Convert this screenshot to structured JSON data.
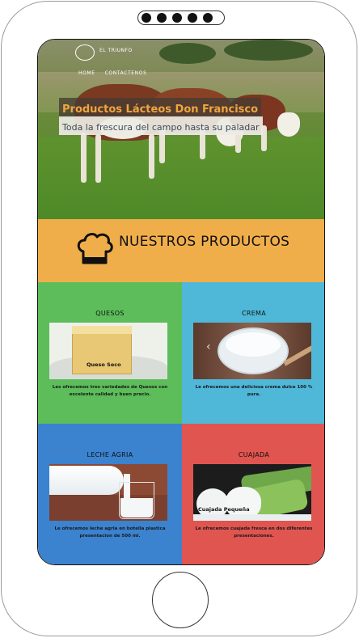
{
  "brand": {
    "name": "EL TRIUNFO"
  },
  "nav": {
    "items": [
      "HOME",
      "CONTACTENOS"
    ]
  },
  "hero": {
    "title": "Productos Lácteos Don Francisco",
    "subtitle": "Toda la frescura del campo hasta su paladar"
  },
  "products_section": {
    "title": "NUESTROS PRODUCTOS"
  },
  "products": [
    {
      "title": "QUESOS",
      "image_label": "Queso Seco",
      "description": "Les ofrecemos tres variedades de Quesos con excelente calidad y buen precio.",
      "color": "#5cbd5a"
    },
    {
      "title": "CREMA",
      "image_label": "",
      "description": "Le ofrecemos una deliciosa crema dulce 100 % pura.",
      "color": "#4fb8d8"
    },
    {
      "title": "LECHE AGRIA",
      "image_label": "",
      "description": "Le ofrecemos leche agria en botella plastica presentacion de 500 ml.",
      "color": "#3b82cf"
    },
    {
      "title": "CUAJADA",
      "image_label": "Cuajada Pequeña",
      "description": "Le ofrecemos cuajada fresca en dos diferentes presentaciones.",
      "color": "#e05550"
    }
  ]
}
